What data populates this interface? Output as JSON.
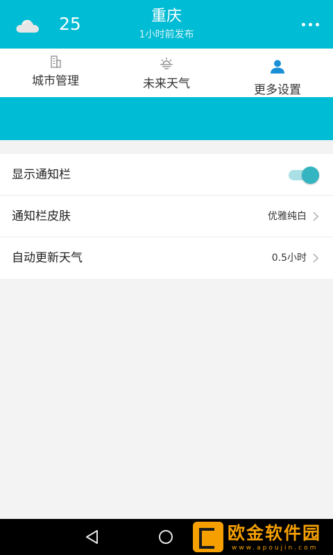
{
  "header": {
    "weather_icon": "cloud-icon",
    "temperature": "25",
    "city": "重庆",
    "publish_time": "1小时前发布",
    "more_icon": "more-dots-icon"
  },
  "tabs": [
    {
      "label": "城市管理",
      "icon": "building-icon"
    },
    {
      "label": "未来天气",
      "icon": "sunrise-icon"
    },
    {
      "label": "更多设置",
      "icon": "person-icon"
    }
  ],
  "settings": {
    "show_notification": {
      "label": "显示通知栏",
      "enabled": true
    },
    "notification_skin": {
      "label": "通知栏皮肤",
      "value": "优雅纯白"
    },
    "auto_update": {
      "label": "自动更新天气",
      "value": "0.5小时"
    }
  },
  "navbar": {
    "icons": [
      "back-icon",
      "home-icon"
    ]
  },
  "watermark": {
    "text": "欧金软件园",
    "url": "www.apoujin.com"
  },
  "colors": {
    "accent": "#00bcd4",
    "toggle_on": "#35b5c2",
    "background": "#f3f3f3"
  }
}
